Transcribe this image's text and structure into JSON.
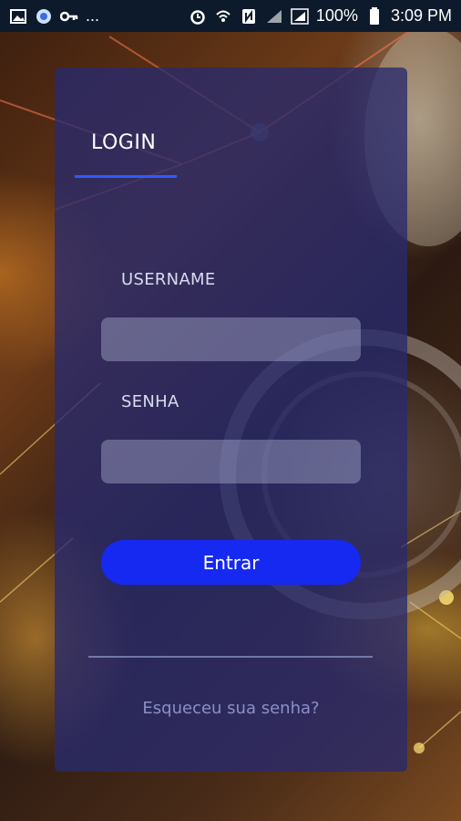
{
  "statusbar": {
    "left_icons": [
      "image-icon",
      "globe-icon",
      "key-icon",
      "more-dots-icon"
    ],
    "dots": "...",
    "battery_percent": "100%",
    "time": "3:09 PM",
    "right_icons": [
      "alarm-icon",
      "wifi-icon",
      "nfc-icon",
      "signal-icon",
      "signal-full-icon",
      "battery-icon"
    ]
  },
  "login": {
    "tab_label": "LOGIN",
    "username_label": "USERNAME",
    "username_value": "",
    "password_label": "SENHA",
    "password_value": "",
    "submit_label": "Entrar",
    "forgot_label": "Esqueceu sua senha?"
  },
  "colors": {
    "card": "#282a6e",
    "accent": "#2f5bff",
    "button": "#1529f0",
    "statusbar": "#0d1a2c"
  }
}
